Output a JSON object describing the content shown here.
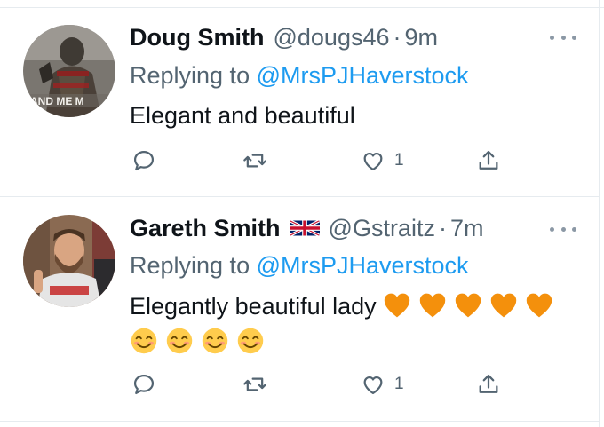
{
  "tweets": [
    {
      "name": "Doug Smith",
      "handle": "@dougs46",
      "separator": "·",
      "time": "9m",
      "replying_prefix": "Replying to ",
      "replying_to": "@MrsPJHaverstock",
      "text": "Elegant and beautiful",
      "like_count": "1",
      "avatar_text": "AND ME M"
    },
    {
      "name": "Gareth Smith",
      "handle": "@Gstraitz",
      "separator": "·",
      "time": "7m",
      "replying_prefix": "Replying to ",
      "replying_to": "@MrsPJHaverstock",
      "text": "Elegantly beautiful lady",
      "like_count": "1",
      "flag_icon": "uk-flag-icon",
      "emojis": [
        "orange-heart",
        "orange-heart",
        "orange-heart",
        "orange-heart",
        "orange-heart",
        "smiling-face",
        "smiling-face",
        "smiling-face",
        "smiling-face"
      ]
    }
  ],
  "colors": {
    "text": "#0f1419",
    "secondary": "#536471",
    "link": "#1d9bf0",
    "divider": "#e6ebef",
    "heart_orange": "#f4900c",
    "smile_yellow": "#ffcc4d"
  },
  "icons": {
    "reply": "reply-icon",
    "retweet": "retweet-icon",
    "like": "like-icon",
    "share": "share-icon",
    "more": "more-icon"
  }
}
